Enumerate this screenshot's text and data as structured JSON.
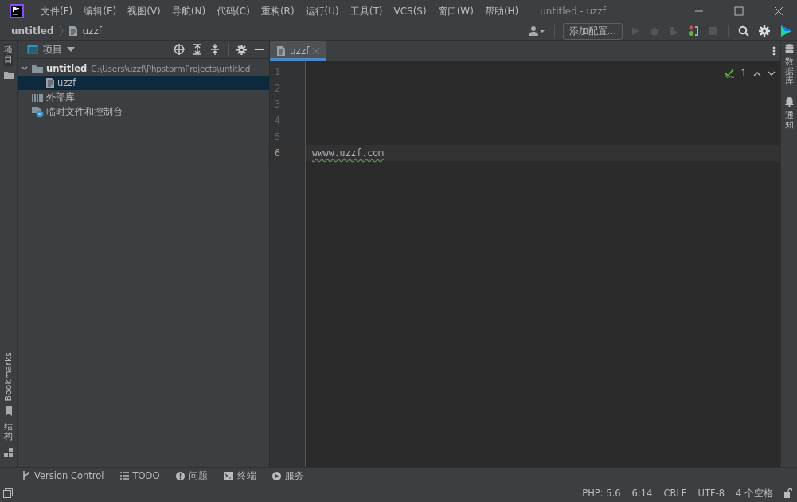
{
  "menu": [
    "文件(F)",
    "编辑(E)",
    "视图(V)",
    "导航(N)",
    "代码(C)",
    "重构(R)",
    "运行(U)",
    "工具(T)",
    "VCS(S)",
    "窗口(W)",
    "帮助(H)"
  ],
  "window": {
    "title": "untitled - uzzf"
  },
  "breadcrumb": [
    "untitled",
    "uzzf"
  ],
  "toolbar": {
    "add_config": "添加配置..."
  },
  "left_strip": [
    {
      "label": "项目",
      "kind": "cjk",
      "selected": true
    },
    {
      "label": "Bookmarks",
      "kind": "latin",
      "selected": false
    },
    {
      "label": "结构",
      "kind": "cjk",
      "selected": false
    }
  ],
  "project": {
    "title": "项目",
    "tree": [
      {
        "label": "untitled",
        "path": "C:\\Users\\uzzf\\PhpstormProjects\\untitled",
        "kind": "folder",
        "expanded": true,
        "selected": false,
        "children": [
          {
            "label": "uzzf",
            "kind": "file",
            "selected": true
          }
        ]
      },
      {
        "label": "外部库",
        "kind": "library",
        "selected": false
      },
      {
        "label": "临时文件和控制台",
        "kind": "scratch",
        "selected": false
      }
    ]
  },
  "editor": {
    "tabs": [
      {
        "label": "uzzf",
        "selected": true
      }
    ],
    "inspection_count": "1",
    "lines": [
      {
        "number": "1",
        "current": false
      },
      {
        "number": "2",
        "current": false
      },
      {
        "number": "3",
        "current": false
      },
      {
        "number": "4",
        "current": false
      },
      {
        "number": "5",
        "current": false
      },
      {
        "number": "6",
        "text": "wwww.uzzf.com",
        "current": true
      }
    ]
  },
  "right_strip": [
    "数据库",
    "通知"
  ],
  "tool_windows": [
    {
      "label": "Version Control",
      "kind": "vcs"
    },
    {
      "label": "TODO",
      "kind": "todo"
    },
    {
      "label": "问题",
      "kind": "problems"
    },
    {
      "label": "终端",
      "kind": "terminal"
    },
    {
      "label": "服务",
      "kind": "services"
    }
  ],
  "status_bar": [
    "PHP: 5.6",
    "6:14",
    "CRLF",
    "UTF-8",
    "4 个空格"
  ]
}
